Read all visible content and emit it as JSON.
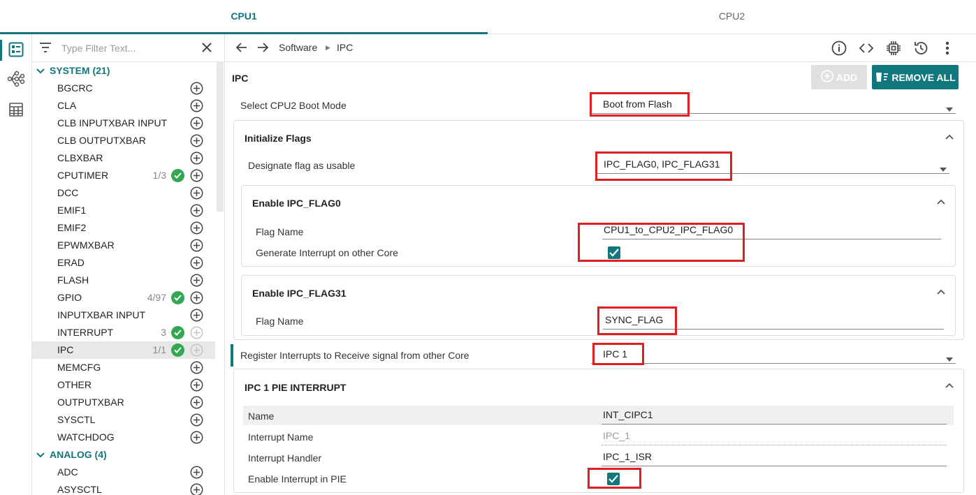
{
  "tabs": [
    "CPU1",
    "CPU2"
  ],
  "sidebar": {
    "filter_placeholder": "Type Filter Text...",
    "groups": [
      {
        "label": "SYSTEM (21)"
      },
      {
        "label": "ANALOG (4)"
      }
    ],
    "items": [
      {
        "name": "BGCRC",
        "count": "",
        "ok": false
      },
      {
        "name": "CLA",
        "count": "",
        "ok": false
      },
      {
        "name": "CLB INPUTXBAR INPUT",
        "count": "",
        "ok": false
      },
      {
        "name": "CLB OUTPUTXBAR",
        "count": "",
        "ok": false
      },
      {
        "name": "CLBXBAR",
        "count": "",
        "ok": false
      },
      {
        "name": "CPUTIMER",
        "count": "1/3",
        "ok": true
      },
      {
        "name": "DCC",
        "count": "",
        "ok": false
      },
      {
        "name": "EMIF1",
        "count": "",
        "ok": false
      },
      {
        "name": "EMIF2",
        "count": "",
        "ok": false
      },
      {
        "name": "EPWMXBAR",
        "count": "",
        "ok": false
      },
      {
        "name": "ERAD",
        "count": "",
        "ok": false
      },
      {
        "name": "FLASH",
        "count": "",
        "ok": false
      },
      {
        "name": "GPIO",
        "count": "4/97",
        "ok": true
      },
      {
        "name": "INPUTXBAR INPUT",
        "count": "",
        "ok": false
      },
      {
        "name": "INTERRUPT",
        "count": "3",
        "ok": true
      },
      {
        "name": "IPC",
        "count": "1/1",
        "ok": true
      },
      {
        "name": "MEMCFG",
        "count": "",
        "ok": false
      },
      {
        "name": "OTHER",
        "count": "",
        "ok": false
      },
      {
        "name": "OUTPUTXBAR",
        "count": "",
        "ok": false
      },
      {
        "name": "SYSCTL",
        "count": "",
        "ok": false
      },
      {
        "name": "WATCHDOG",
        "count": "",
        "ok": false
      }
    ],
    "analog_items": [
      {
        "name": "ADC",
        "count": "",
        "ok": false
      },
      {
        "name": "ASYSCTL",
        "count": "",
        "ok": false
      }
    ]
  },
  "breadcrumb": [
    "Software",
    "IPC"
  ],
  "main": {
    "title": "IPC",
    "add_label": "ADD",
    "remove_all_label": "REMOVE ALL",
    "boot_mode_label": "Select CPU2 Boot Mode",
    "boot_mode_value": "Boot from Flash",
    "init_flags_title": "Initialize Flags",
    "designate_label": "Designate flag as usable",
    "designate_value": "IPC_FLAG0, IPC_FLAG31",
    "flag0_title": "Enable IPC_FLAG0",
    "flag0_name_label": "Flag Name",
    "flag0_name_value": "CPU1_to_CPU2_IPC_FLAG0",
    "flag0_interrupt_label": "Generate Interrupt on other Core",
    "flag31_title": "Enable IPC_FLAG31",
    "flag31_name_label": "Flag Name",
    "flag31_name_value": "SYNC_FLAG",
    "register_label": "Register Interrupts to Receive signal from other Core",
    "register_value": "IPC 1",
    "pie_title": "IPC 1 PIE INTERRUPT",
    "pie_rows": [
      {
        "label": "Name",
        "value": "INT_CIPC1"
      },
      {
        "label": "Interrupt Name",
        "value": "IPC_1"
      },
      {
        "label": "Interrupt Handler",
        "value": "IPC_1_ISR"
      },
      {
        "label": "Enable Interrupt in PIE",
        "value": ""
      }
    ]
  },
  "colors": {
    "accent": "#11777f",
    "ok": "#33a853",
    "highlight": "#e02020"
  }
}
